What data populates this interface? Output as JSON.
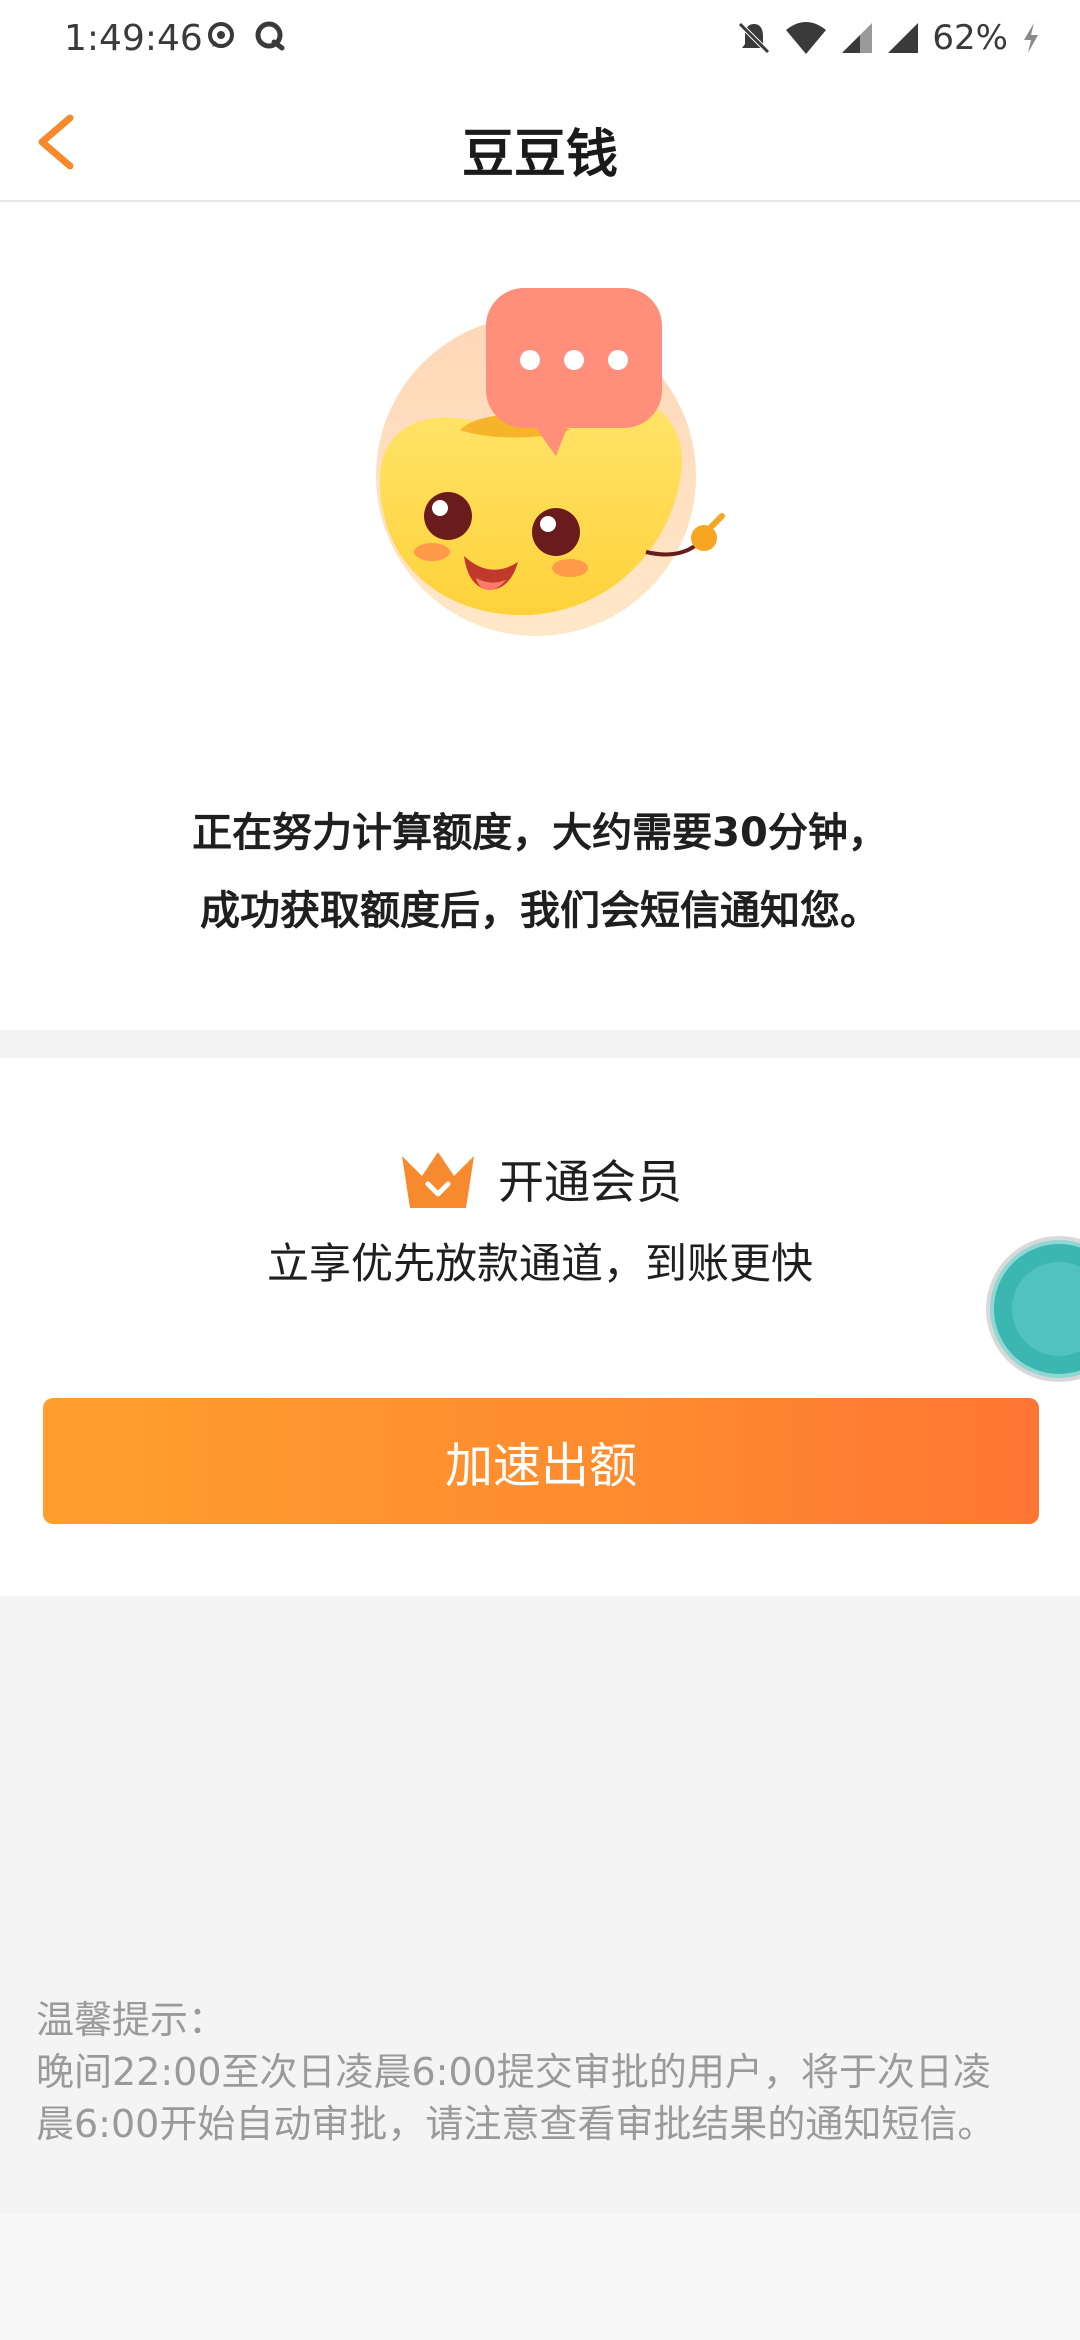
{
  "status_bar": {
    "time": "1:49:46",
    "battery_percent": "62%",
    "icons": [
      "chat-bubble-icon",
      "q-app-icon",
      "mute-bell-icon",
      "wifi-icon",
      "signal-icon",
      "signal-icon",
      "charging-icon"
    ]
  },
  "header": {
    "title": "豆豆钱",
    "back_icon": "chevron-left-icon",
    "accent_color": "#f5892b"
  },
  "status_card": {
    "mascot_icon": "bean-mascot-chat-icon",
    "line1": "正在努力计算额度，大约需要30分钟，",
    "line2": "成功获取额度后，我们会短信通知您。"
  },
  "member_card": {
    "crown_icon": "crown-icon",
    "title": "开通会员",
    "subtitle": "立享优先放款通道，到账更快",
    "button_label": "加速出额",
    "button_color_start": "#ff9f2f",
    "button_color_end": "#ff7634"
  },
  "tips": {
    "heading": "温馨提示：",
    "line1": "晚间22:00至次日凌晨6:00提交审批的用户，将于次日凌",
    "line2": "晨6:00开始自动审批，请注意查看审批结果的通知短信。"
  }
}
